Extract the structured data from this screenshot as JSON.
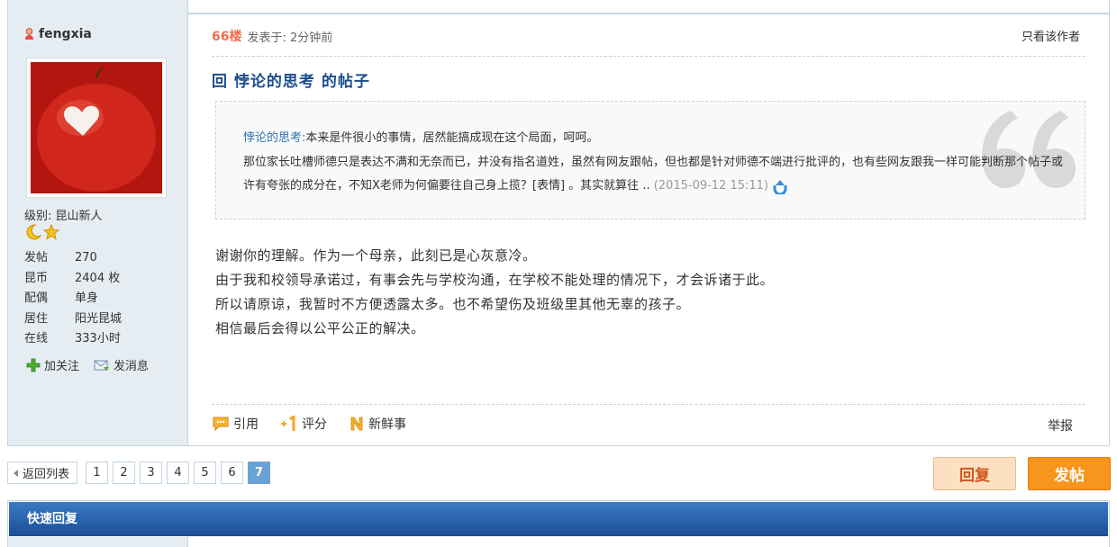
{
  "author": {
    "name": "fengxia",
    "level_label": "级别: 昆山新人",
    "stats": [
      {
        "label": "发帖",
        "value": "270"
      },
      {
        "label": "昆币",
        "value": "2404 枚"
      },
      {
        "label": "配偶",
        "value": "单身"
      },
      {
        "label": "居住",
        "value": "阳光昆城"
      },
      {
        "label": "在线",
        "value": "333小时"
      }
    ],
    "follow_label": "加关注",
    "message_label": "发消息"
  },
  "post": {
    "floor": "66楼",
    "posted_at": "发表于: 2分钟前",
    "only_author": "只看该作者",
    "title": "回 悖论的思考 的帖子",
    "quote": {
      "user": "悖论的思考:",
      "line1": "本来是件很小的事情，居然能搞成现在这个局面，呵呵。",
      "line2": "那位家长吐槽师德只是表达不满和无奈而已，并没有指名道姓，虽然有网友跟帖，但也都是针对师德不端进行批评的，也有些网友跟我一样可能判断那个帖子或许有夸张的成分在，不知X老师为何偏要往自己身上揽？[表情] 。其实就算往 .. ",
      "time": "(2015-09-12 15:11)"
    },
    "body": [
      "谢谢你的理解。作为一个母亲，此刻已是心灰意冷。",
      "由于我和校领导承诺过，有事会先与学校沟通，在学校不能处理的情况下，才会诉诸于此。",
      "所以请原谅，我暂时不方便透露太多。也不希望伤及班级里其他无辜的孩子。",
      "相信最后会得以公平公正的解决。"
    ],
    "actions": {
      "quote": "引用",
      "rate": "评分",
      "news": "新鲜事",
      "report": "举报"
    }
  },
  "pager": {
    "back_label": "返回列表",
    "pages": [
      "1",
      "2",
      "3",
      "4",
      "5",
      "6",
      "7"
    ],
    "current": "7"
  },
  "buttons": {
    "reply": "回复",
    "post": "发帖"
  },
  "quick_reply": {
    "title": "快速回复"
  },
  "colors": {
    "accent_blue": "#1e4e8c",
    "floor_orange": "#f26c4f",
    "post_button": "#f7951c"
  }
}
